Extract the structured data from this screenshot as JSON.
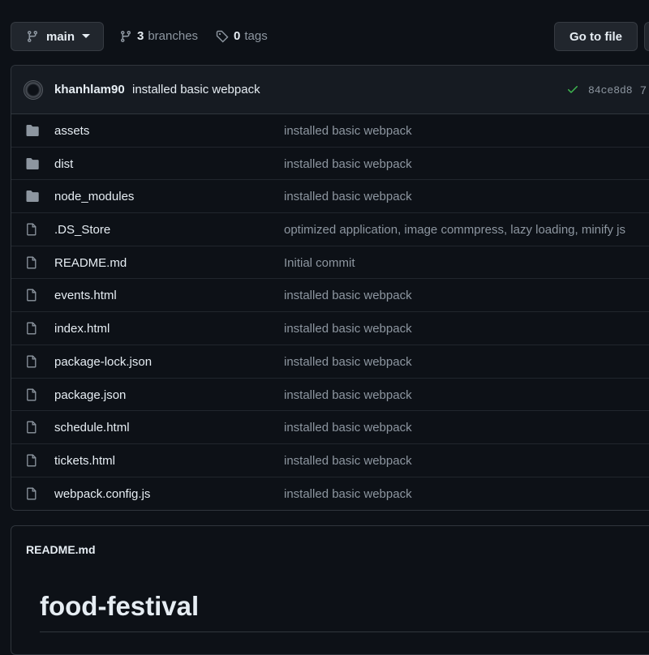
{
  "toolbar": {
    "branch_label": "main",
    "branches_count": "3",
    "branches_label": "branches",
    "tags_count": "0",
    "tags_label": "tags",
    "goto_file_label": "Go to file"
  },
  "commit": {
    "author": "khanhlam90",
    "message": "installed basic webpack",
    "sha": "84ce8d8",
    "extra": "7",
    "status_color": "#3fb950"
  },
  "files": [
    {
      "name": "assets",
      "type": "folder",
      "message": "installed basic webpack"
    },
    {
      "name": "dist",
      "type": "folder",
      "message": "installed basic webpack"
    },
    {
      "name": "node_modules",
      "type": "folder",
      "message": "installed basic webpack"
    },
    {
      "name": ".DS_Store",
      "type": "file",
      "message": "optimized application, image commpress, lazy loading, minify js"
    },
    {
      "name": "README.md",
      "type": "file",
      "message": "Initial commit"
    },
    {
      "name": "events.html",
      "type": "file",
      "message": "installed basic webpack"
    },
    {
      "name": "index.html",
      "type": "file",
      "message": "installed basic webpack"
    },
    {
      "name": "package-lock.json",
      "type": "file",
      "message": "installed basic webpack"
    },
    {
      "name": "package.json",
      "type": "file",
      "message": "installed basic webpack"
    },
    {
      "name": "schedule.html",
      "type": "file",
      "message": "installed basic webpack"
    },
    {
      "name": "tickets.html",
      "type": "file",
      "message": "installed basic webpack"
    },
    {
      "name": "webpack.config.js",
      "type": "file",
      "message": "installed basic webpack"
    }
  ],
  "readme": {
    "filename": "README.md",
    "title": "food-festival"
  },
  "colors": {
    "background": "#0d1117",
    "text": "#e6edf3",
    "muted": "#8d96a0",
    "folder_icon": "#8d96a0"
  }
}
